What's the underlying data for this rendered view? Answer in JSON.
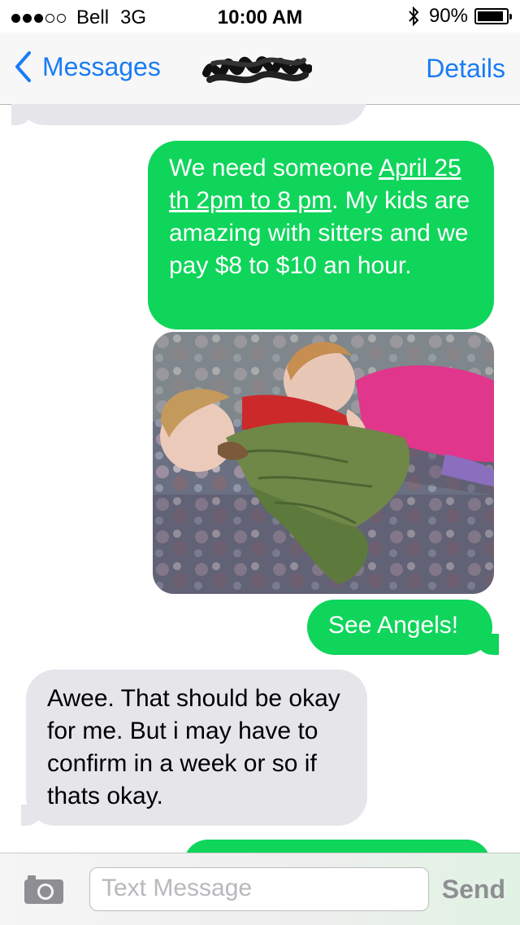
{
  "status_bar": {
    "signal_dots_filled": 3,
    "signal_dots_total": 5,
    "carrier": "Bell",
    "network": "3G",
    "time": "10:00 AM",
    "battery_percent": "90%",
    "battery_level": 0.9
  },
  "nav": {
    "back_label": "Messages",
    "details_label": "Details",
    "back_icon": "chevron-left-icon"
  },
  "messages": {
    "msg1": {
      "p1": "We need someone ",
      "link": "April 25 th 2pm to 8 pm",
      "p2": ". My kids are amazing with sitters and we pay $8 to $10 an hour."
    },
    "msg2": "See Angels!",
    "msg3": " Awee. That should be okay for me. But i may have to confirm in a week or so if thats okay."
  },
  "input": {
    "placeholder": "Text Message",
    "send_label": "Send",
    "camera_icon": "camera-icon"
  },
  "colors": {
    "accent": "#1a7cf5",
    "outgoing_bubble": "#0fd55b",
    "incoming_bubble": "#e5e5ea"
  }
}
